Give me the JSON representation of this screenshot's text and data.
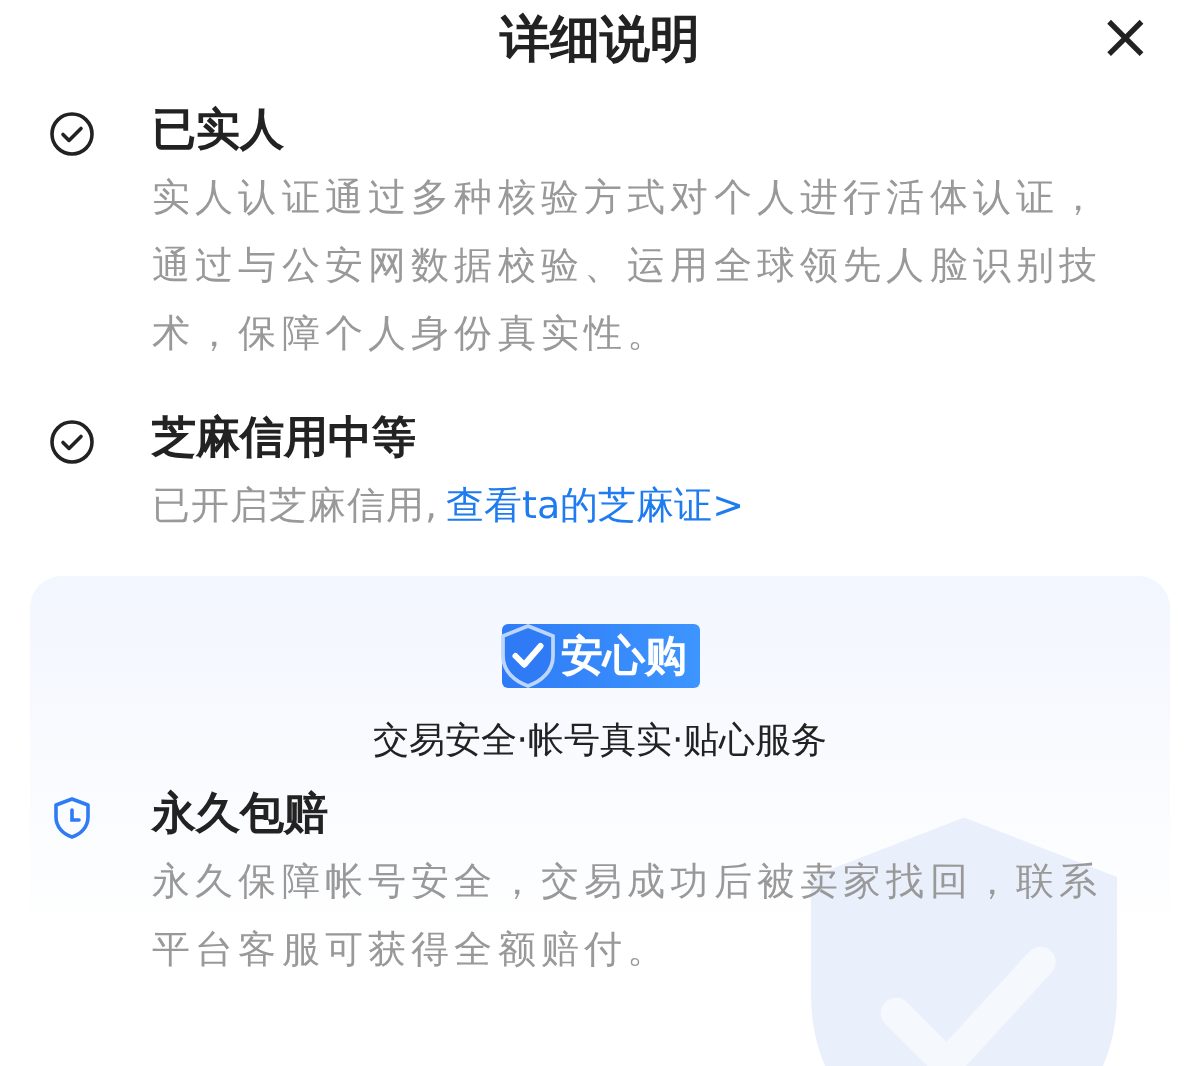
{
  "title": "详细说明",
  "close_icon": "×",
  "items": [
    {
      "kind": "check",
      "title": "已实人",
      "description": "实人认证通过多种核验方式对个人进行活体认证，通过与公安网数据校验、运用全球领先人脸识别技术，保障个人身份真实性。"
    },
    {
      "kind": "check",
      "title": "芝麻信用中等",
      "description": "已开启芝麻信用,",
      "link": "查看ta的芝麻证>"
    }
  ],
  "guarantee": {
    "badge": "安心购",
    "tagline": "交易安全·帐号真实·贴心服务",
    "items": [
      {
        "kind": "clock",
        "title": "永久包赔",
        "description": "永久保障帐号安全，交易成功后被卖家找回，联系平台客服可获得全额赔付。"
      }
    ]
  }
}
